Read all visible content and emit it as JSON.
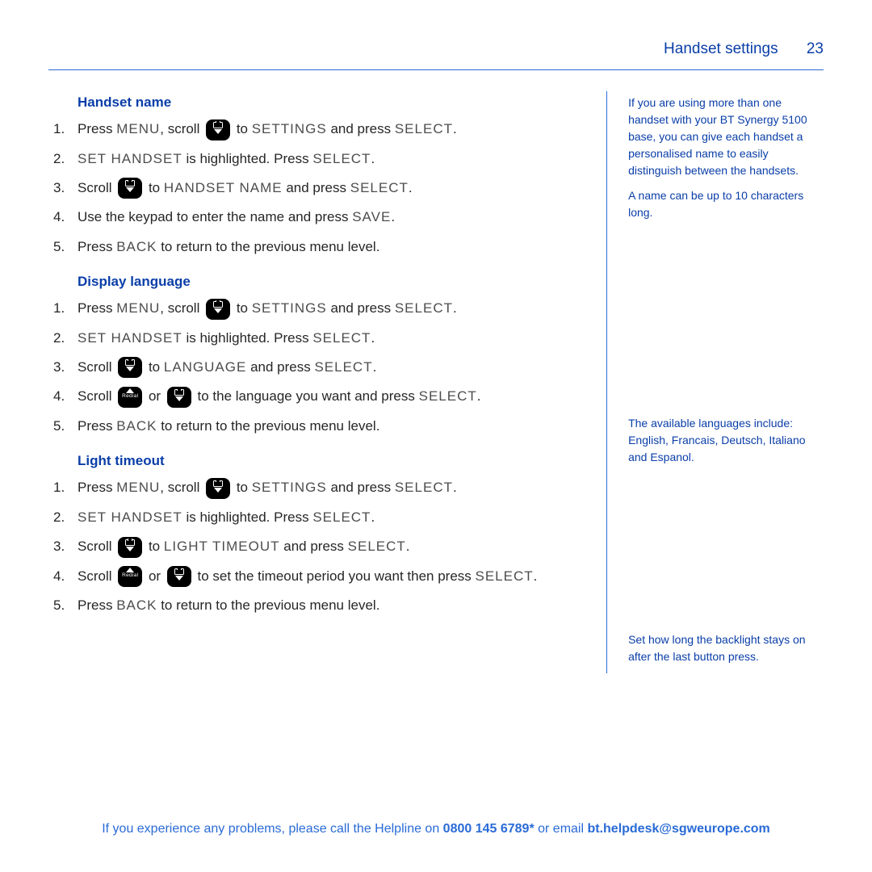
{
  "header": {
    "title": "Handset settings",
    "page_number": "23"
  },
  "sections": [
    {
      "heading": "Handset name",
      "steps": [
        {
          "pre": "Press ",
          "lcd1": "MENU",
          "mid1": ", scroll ",
          "key1": "down",
          "mid2": "  to ",
          "lcd2": "SETTINGS",
          "mid3": " and press ",
          "lcd3": "SELECT",
          "post": "."
        },
        {
          "pre": "",
          "lcd1": "SET HANDSET",
          "mid1": " is highlighted. Press ",
          "lcd2": "SELECT",
          "post": "."
        },
        {
          "pre": "Scroll ",
          "key1": "down",
          "mid1": "  to ",
          "lcd1": "HANDSET NAME",
          "mid2": " and press ",
          "lcd2": "SELECT",
          "post": "."
        },
        {
          "pre": "Use the keypad to enter the name and press ",
          "lcd1": "SAVE",
          "post": "."
        },
        {
          "pre": "Press ",
          "lcd1": "BACK",
          "mid1": " to return to the previous menu level.",
          "post": ""
        }
      ]
    },
    {
      "heading": "Display language",
      "steps": [
        {
          "pre": "Press ",
          "lcd1": "MENU",
          "mid1": ", scroll ",
          "key1": "down",
          "mid2": " to ",
          "lcd2": "SETTINGS",
          "mid3": " and press ",
          "lcd3": "SELECT",
          "post": "."
        },
        {
          "pre": "",
          "lcd1": "SET HANDSET",
          "mid1": " is highlighted. Press ",
          "lcd2": "SELECT",
          "post": "."
        },
        {
          "pre": "Scroll ",
          "key1": "down",
          "mid1": " to ",
          "lcd1": "LANGUAGE",
          "mid2": " and press ",
          "lcd2": "SELECT",
          "post": "."
        },
        {
          "pre": "Scroll ",
          "key1": "up",
          "mid1": " or ",
          "key2": "down",
          "mid2": " to the language you want and press ",
          "lcd1": "SELECT",
          "post": "."
        },
        {
          "pre": "Press ",
          "lcd1": "BACK",
          "mid1": " to return to the previous menu level.",
          "post": ""
        }
      ]
    },
    {
      "heading": "Light timeout",
      "steps": [
        {
          "pre": "Press ",
          "lcd1": "MENU",
          "mid1": ", scroll ",
          "key1": "down",
          "mid2": " to ",
          "lcd2": "SETTINGS",
          "mid3": " and press ",
          "lcd3": "SELECT",
          "post": "."
        },
        {
          "pre": "",
          "lcd1": "SET HANDSET",
          "mid1": " is highlighted. Press ",
          "lcd2": "SELECT",
          "post": "."
        },
        {
          "pre": "Scroll ",
          "key1": "down",
          "mid1": " to ",
          "lcd1": "LIGHT TIMEOUT",
          "mid2": " and press ",
          "lcd2": "SELECT",
          "post": "."
        },
        {
          "pre": "Scroll ",
          "key1": "up",
          "mid1": " or ",
          "key2": "down",
          "mid2": " to set the timeout period you want then press ",
          "lcd1": "SELECT",
          "post": "."
        },
        {
          "pre": "Press ",
          "lcd1": "BACK",
          "mid1": " to return to the previous menu level.",
          "post": ""
        }
      ]
    }
  ],
  "notes": {
    "group1": [
      "If you are using more than one handset with your BT Synergy 5100 base, you can give each handset a personalised name to easily distinguish between the handsets.",
      "A name can be up to 10 characters long."
    ],
    "group2": [
      "The available languages include: English, Francais, Deutsch, Italiano and Espanol."
    ],
    "group3": [
      "Set how long the backlight stays on after the last button press."
    ]
  },
  "footer": {
    "pre": "If you experience any problems, please call the Helpline on ",
    "phone": "0800 145 6789*",
    "mid": " or email ",
    "email": "bt.helpdesk@sgweurope.com"
  },
  "key_up_label": "Redial"
}
